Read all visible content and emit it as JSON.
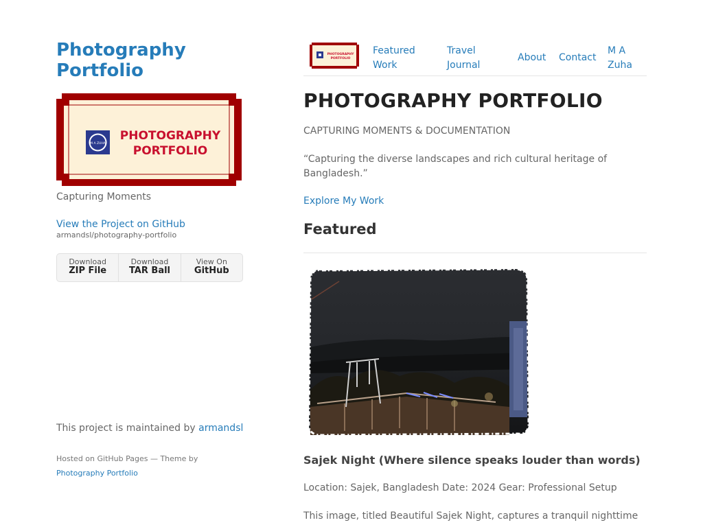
{
  "site": {
    "title": "Photography Portfolio",
    "tagline": "Capturing Moments",
    "github_link": "View the Project on GitHub",
    "github_repo": "armandsl/photography-portfolio",
    "logo": {
      "title_line1": "PHOTOGRAPHY",
      "title_line2": "PORTFOLIO",
      "badge": "M A ZUHA",
      "frame_color": "#A00000",
      "inner_color": "#FDF1D8",
      "text_color": "#C8102E"
    }
  },
  "downloads": [
    {
      "small": "Download",
      "big": "ZIP File"
    },
    {
      "small": "Download",
      "big": "TAR Ball"
    },
    {
      "small": "View On",
      "big": "GitHub"
    }
  ],
  "footer": {
    "maintained_prefix": "This project is maintained by",
    "maintained_user": "armandsl",
    "hosted_prefix": "Hosted on GitHub Pages — Theme by",
    "hosted_theme": "Photography Portfolio"
  },
  "nav": {
    "items": [
      {
        "line1": "Featured",
        "line2": "Work"
      },
      {
        "line1": "Travel",
        "line2": "Journal"
      },
      {
        "line1": "About",
        "line2": ""
      },
      {
        "line1": "Contact",
        "line2": ""
      },
      {
        "line1": "M A",
        "line2": "Zuha"
      }
    ]
  },
  "main": {
    "title": "PHOTOGRAPHY PORTFOLIO",
    "subtitle": "CAPTURING MOMENTS & DOCUMENTATION",
    "quote": "“Capturing the diverse landscapes and rich cultural heritage of Bangladesh.”",
    "explore": "Explore My Work",
    "featured_heading": "Featured",
    "photo": {
      "caption": "Sajek Night (Where silence speaks louder than words)",
      "meta": "Location: Sajek, Bangladesh Date: 2024 Gear: Professional Setup",
      "description": "This image, titled Beautiful Sajek Night, captures a tranquil nighttime"
    }
  },
  "colors": {
    "link": "#267CB9",
    "heading": "#222222",
    "body_text": "#666666"
  }
}
